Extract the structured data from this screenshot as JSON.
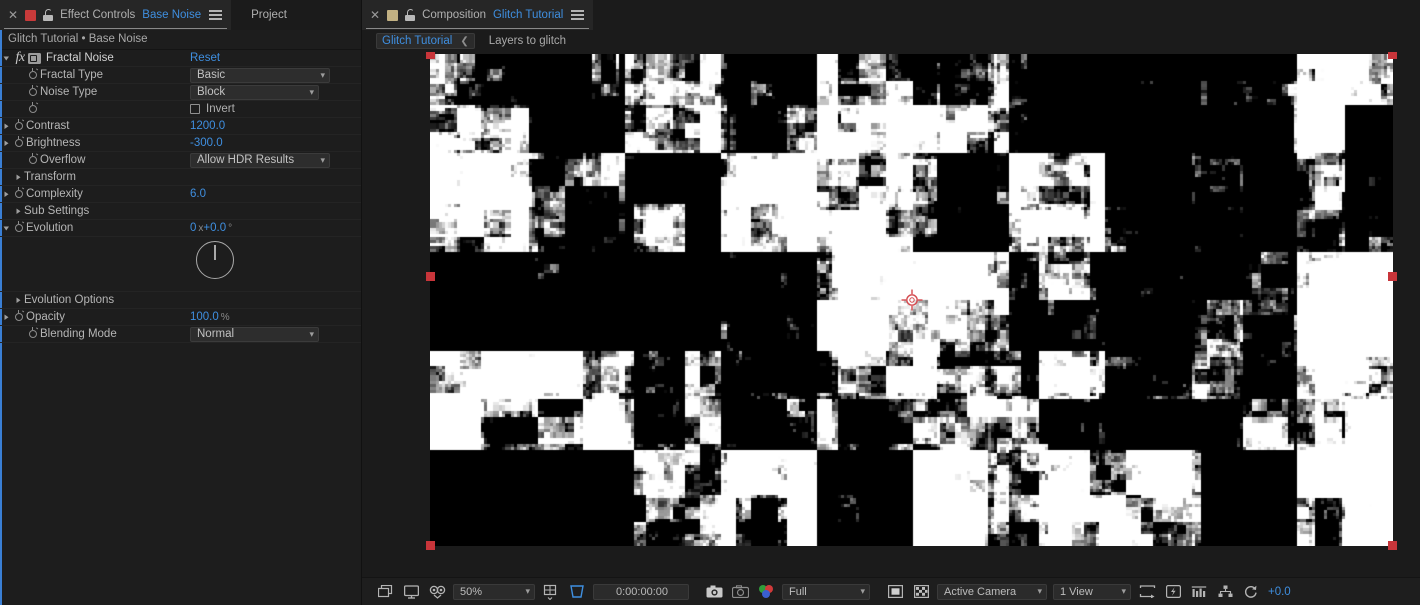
{
  "effect_controls": {
    "tab": {
      "close_icon": "close-icon",
      "swatch_color": "#c83a3a",
      "lock_icon": "lock-icon",
      "label": "Effect Controls",
      "item": "Base Noise",
      "menu_icon": "panel-menu-icon"
    },
    "project_tab": "Project",
    "breadcrumb": "Glitch Tutorial • Base Noise",
    "effect": {
      "name": "Fractal Noise",
      "reset": "Reset"
    },
    "properties": [
      {
        "label": "Fractal Type",
        "value": "Basic",
        "type": "dropdown"
      },
      {
        "label": "Noise Type",
        "value": "Block",
        "type": "dropdown"
      },
      {
        "label": "",
        "value": "Invert",
        "type": "checkbox",
        "checked": false
      },
      {
        "label": "Contrast",
        "value": "1200.0",
        "type": "number"
      },
      {
        "label": "Brightness",
        "value": "-300.0",
        "type": "number"
      },
      {
        "label": "Overflow",
        "value": "Allow HDR Results",
        "type": "dropdown"
      },
      {
        "label": "Transform",
        "value": "",
        "type": "group"
      },
      {
        "label": "Complexity",
        "value": "6.0",
        "type": "number"
      },
      {
        "label": "Sub Settings",
        "value": "",
        "type": "group"
      },
      {
        "label": "Evolution",
        "value": "0 x+0.0 °",
        "type": "angle"
      },
      {
        "label": "Evolution Options",
        "value": "",
        "type": "group"
      },
      {
        "label": "Opacity",
        "value": "100.0",
        "unit": "%",
        "type": "number"
      },
      {
        "label": "Blending Mode",
        "value": "Normal",
        "type": "dropdown"
      }
    ],
    "evolution": {
      "revolutions": "0",
      "x_sep": "x",
      "degrees": "+0.0",
      "degree_symbol": "°",
      "dial_angle": 0
    },
    "opacity": {
      "value": "100.0",
      "unit": "%"
    }
  },
  "composition": {
    "tab": {
      "close_icon": "close-icon",
      "swatch_color": "#c2b183",
      "lock_icon": "lock-icon",
      "label": "Composition",
      "item": "Glitch Tutorial",
      "menu_icon": "panel-menu-icon"
    },
    "breadcrumb": {
      "comp_name": "Glitch Tutorial",
      "back_icon": "chevron-left-icon",
      "note": "Layers to glitch"
    },
    "toolbar": {
      "always_preview_icon": "always-preview-icon",
      "main_view_icon": "main-view-icon",
      "mask_view_icon": "mask-view-icon",
      "zoom": "50%",
      "grid_choice_icon": "grid-guides-icon",
      "region_of_interest_icon": "region-of-interest-icon",
      "timecode": "0:00:00:00",
      "snapshot_icon": "snapshot-camera-icon",
      "show_snapshot_icon": "show-snapshot-icon",
      "channels_icon": "rgb-channels-icon",
      "resolution": "Full",
      "transparency_grid_icon": "transparency-grid-icon",
      "toggle_alpha_icon": "toggle-alpha-icon",
      "camera": "Active Camera",
      "views": "1 View",
      "pixel_aspect_icon": "pixel-aspect-icon",
      "fast_previews_icon": "fast-previews-icon",
      "timeline_icon": "timeline-icon",
      "flowchart_icon": "comp-flowchart-icon",
      "exposure_reset_icon": "exposure-reset-icon",
      "exposure": "+0.0"
    },
    "canvas": {
      "background": "#000000",
      "noise_color": "#ffffff",
      "handle_color": "#c8353a",
      "anchor_icon": "anchor-point-icon"
    }
  }
}
